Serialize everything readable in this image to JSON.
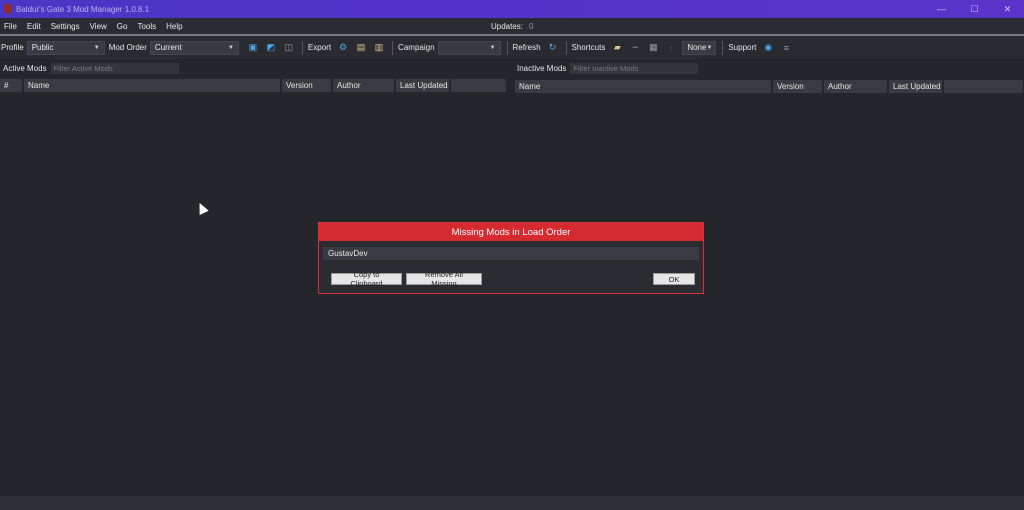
{
  "window": {
    "title": "Baldur's Gate 3 Mod Manager 1.0.8.1",
    "controls": {
      "minimize": "—",
      "maximize": "☐",
      "close": "✕"
    }
  },
  "menu": {
    "items": [
      "File",
      "Edit",
      "Settings",
      "View",
      "Go",
      "Tools",
      "Help"
    ],
    "updates_label": "Updates:",
    "updates_count": "0"
  },
  "toolbar": {
    "profile_label": "Profile",
    "profile_value": "Public",
    "mod_order_label": "Mod Order",
    "mod_order_value": "Current",
    "export_label": "Export",
    "campaign_label": "Campaign",
    "campaign_value": "",
    "refresh_label": "Refresh",
    "shortcuts_label": "Shortcuts",
    "none_value": "None",
    "support_label": "Support"
  },
  "active_mods": {
    "label": "Active Mods",
    "filter_placeholder": "Filter Active Mods",
    "columns": [
      "#",
      "Name",
      "Version",
      "Author",
      "Last Updated",
      ""
    ]
  },
  "inactive_mods": {
    "label": "Inactive Mods",
    "filter_placeholder": "Filter Inactive Mods",
    "columns": [
      "Name",
      "Version",
      "Author",
      "Last Updated",
      ""
    ]
  },
  "dialog": {
    "title": "Missing Mods in Load Order",
    "missing_items": [
      "GustavDev"
    ],
    "copy_button": "Copy to Clipboard",
    "remove_button": "Remove All Missing",
    "ok_button": "OK"
  },
  "colors": {
    "titlebar": "#5233cc",
    "dialog_header": "#d52a2f",
    "background": "#25252c"
  }
}
